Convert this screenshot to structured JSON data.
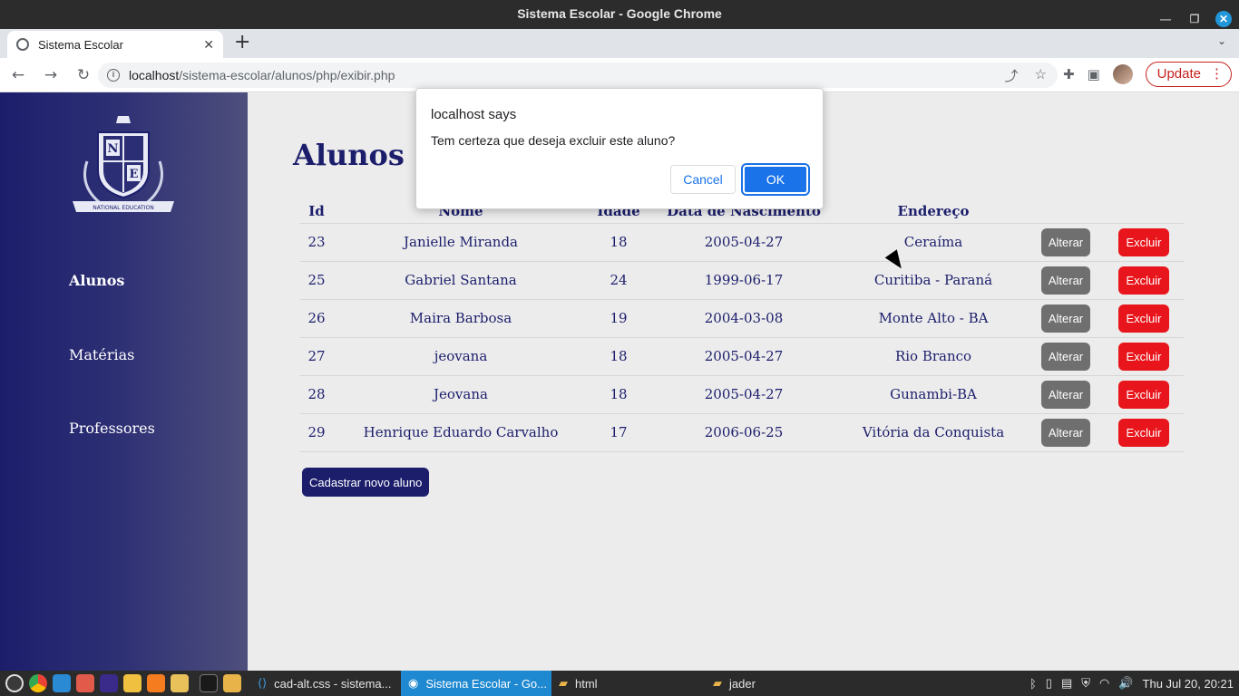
{
  "window": {
    "title": "Sistema Escolar - Google Chrome"
  },
  "tab": {
    "title": "Sistema Escolar"
  },
  "address": {
    "host": "localhost",
    "path": "/sistema-escolar/alunos/php/exibir.php"
  },
  "toolbar": {
    "update_label": "Update"
  },
  "sidebar": {
    "logo_text": "NATIONAL EDUCATION",
    "logo_letters": [
      "N",
      "E"
    ],
    "items": [
      {
        "label": "Alunos",
        "active": true
      },
      {
        "label": "Matérias",
        "active": false
      },
      {
        "label": "Professores",
        "active": false
      }
    ]
  },
  "main": {
    "title": "Alunos Ca",
    "columns": [
      "Id",
      "Nome",
      "Idade",
      "Data de Nascimento",
      "Endereço"
    ],
    "rows": [
      {
        "id": "23",
        "nome": "Janielle Miranda",
        "idade": "18",
        "nascimento": "2005-04-27",
        "endereco": "Ceraíma"
      },
      {
        "id": "25",
        "nome": "Gabriel Santana",
        "idade": "24",
        "nascimento": "1999-06-17",
        "endereco": "Curitiba - Paraná"
      },
      {
        "id": "26",
        "nome": "Maira Barbosa",
        "idade": "19",
        "nascimento": "2004-03-08",
        "endereco": "Monte Alto - BA"
      },
      {
        "id": "27",
        "nome": "jeovana",
        "idade": "18",
        "nascimento": "2005-04-27",
        "endereco": "Rio Branco"
      },
      {
        "id": "28",
        "nome": "Jeovana",
        "idade": "18",
        "nascimento": "2005-04-27",
        "endereco": "Gunambi-BA"
      },
      {
        "id": "29",
        "nome": "Henrique Eduardo Carvalho",
        "idade": "17",
        "nascimento": "2006-06-25",
        "endereco": "Vitória da Conquista"
      }
    ],
    "alter_label": "Alterar",
    "delete_label": "Excluir",
    "new_button": "Cadastrar novo aluno"
  },
  "dialog": {
    "title": "localhost says",
    "message": "Tem certeza que deseja excluir este aluno?",
    "cancel": "Cancel",
    "ok": "OK"
  },
  "taskbar": {
    "tasks": [
      {
        "label": "cad-alt.css - sistema...",
        "icon": "vscode-icon",
        "active": false
      },
      {
        "label": "Sistema Escolar - Go...",
        "icon": "chrome-icon",
        "active": true
      },
      {
        "label": "html",
        "icon": "folder-icon",
        "active": false
      },
      {
        "label": "jader",
        "icon": "folder-icon",
        "active": false
      }
    ],
    "clock": "Thu Jul 20, 20:21"
  },
  "colors": {
    "primary": "#1c1e6c",
    "danger": "#e8161c",
    "secondary": "#6f6f6f",
    "dialog_button": "#1a73e8"
  }
}
